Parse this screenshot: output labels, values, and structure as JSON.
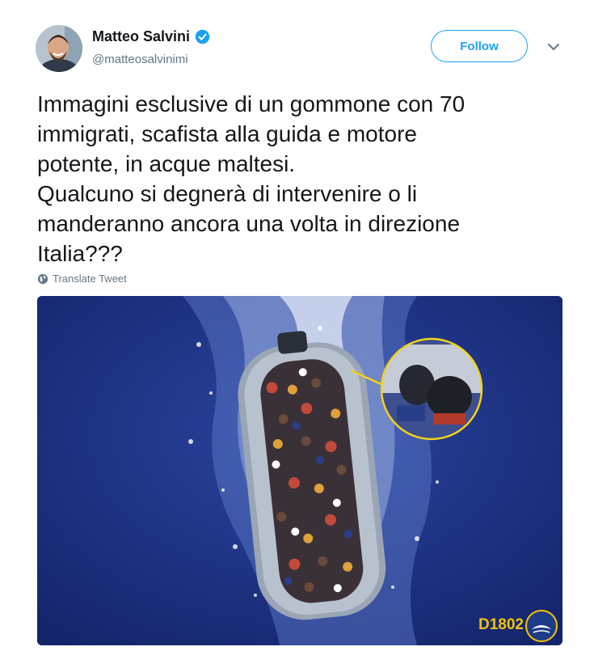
{
  "tweet": {
    "author": {
      "display_name": "Matteo Salvini",
      "handle": "@matteosalvinimi",
      "verified": true,
      "avatar_icon": "avatar-photo"
    },
    "follow_label": "Follow",
    "text_lines": [
      "Immagini esclusive di un gommone con 70",
      "immigrati, scafista alla guida e motore",
      "potente, in acque maltesi.",
      "Qualcuno si degnerà di intervenire o li",
      "manderanno ancora una volta in direzione",
      "Italia???"
    ],
    "translate_label": "Translate Tweet",
    "media": {
      "caption_code": "D1802"
    }
  },
  "colors": {
    "accent": "#1da1f2",
    "secondary_text": "#657786",
    "sea": "#1b2f78",
    "caption": "#f2c200"
  }
}
